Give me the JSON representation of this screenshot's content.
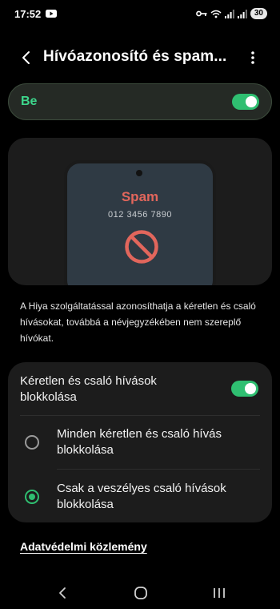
{
  "status_bar": {
    "time": "17:52",
    "battery": "30"
  },
  "header": {
    "title": "Hívóazonosító és spam..."
  },
  "master_switch": {
    "label": "Be",
    "on": true
  },
  "illustration": {
    "spam_label": "Spam",
    "phone_number": "012 3456 7890"
  },
  "description": "A Hiya szolgáltatással azonosíthatja a kéretlen és csaló hívásokat, továbbá a névjegyzékében nem szereplő hívókat.",
  "block_setting": {
    "toggle_label": "Kéretlen és csaló hívások blokkolása",
    "on": true,
    "options": [
      {
        "label": "Minden kéretlen és csaló hívás blokkolása",
        "selected": false
      },
      {
        "label": "Csak a veszélyes csaló hívások blokkolása",
        "selected": true
      }
    ]
  },
  "privacy_link": "Adatvédelmi közlemény",
  "colors": {
    "accent": "#2fbf71",
    "accent_text": "#3dd68c",
    "spam_red": "#e2665c",
    "card_bg": "#1c1c1c",
    "page_bg": "#000000"
  },
  "icons": {
    "back": "back-arrow-icon",
    "more": "more-vert-icon",
    "block": "block-icon"
  }
}
